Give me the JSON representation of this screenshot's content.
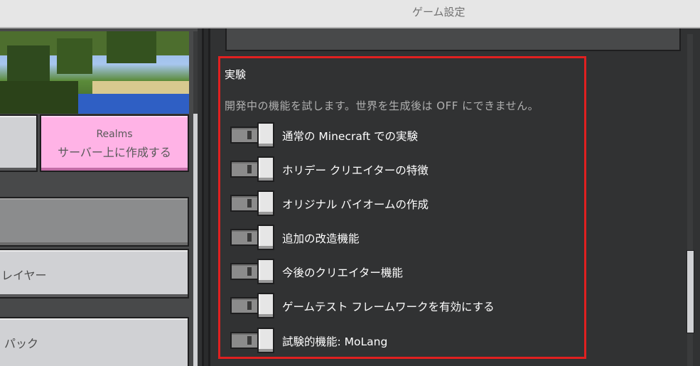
{
  "window": {
    "title": "ゲーム設定"
  },
  "left_panel": {
    "realms_button": {
      "line1": "Realms",
      "line2": "サーバー上に作成する"
    },
    "player_button_label": "レイヤー",
    "pack_button_label": "パック"
  },
  "experiments": {
    "title": "実験",
    "description": "開発中の機能を試します。世界を生成後は OFF にできません。",
    "toggles": [
      {
        "label": "通常の Minecraft での実験",
        "value": "off"
      },
      {
        "label": "ホリデー クリエイターの特徴",
        "value": "off"
      },
      {
        "label": "オリジナル バイオームの作成",
        "value": "off"
      },
      {
        "label": "追加の改造機能",
        "value": "off"
      },
      {
        "label": "今後のクリエイター機能",
        "value": "off"
      },
      {
        "label": "ゲームテスト フレームワークを有効にする",
        "value": "off"
      },
      {
        "label": "試験的機能: MoLang",
        "value": "off"
      }
    ]
  },
  "colors": {
    "background": "#313233",
    "highlight_border": "#e02020",
    "realms_button": "#ffb3e6"
  }
}
